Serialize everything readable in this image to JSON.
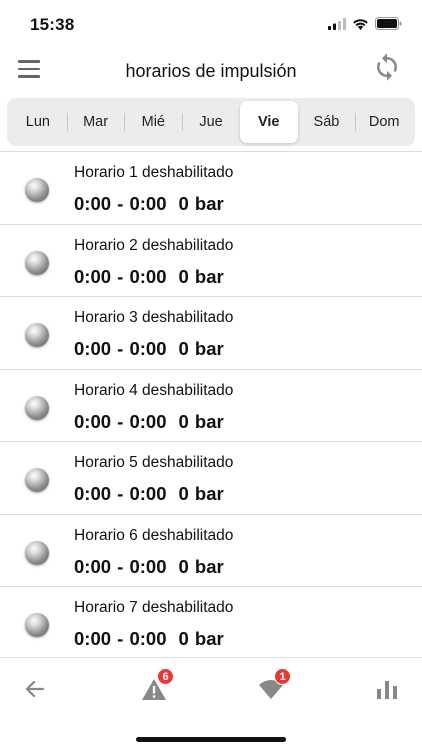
{
  "status_bar": {
    "time": "15:38"
  },
  "header": {
    "title": "horarios de impulsión"
  },
  "days": [
    {
      "label": "Lun",
      "active": false
    },
    {
      "label": "Mar",
      "active": false
    },
    {
      "label": "Mié",
      "active": false
    },
    {
      "label": "Jue",
      "active": false
    },
    {
      "label": "Vie",
      "active": true
    },
    {
      "label": "Sáb",
      "active": false
    },
    {
      "label": "Dom",
      "active": false
    }
  ],
  "schedules": [
    {
      "label": "Horario 1 deshabilitado",
      "time": "0:00 - 0:00",
      "pressure": "0 bar"
    },
    {
      "label": "Horario 2 deshabilitado",
      "time": "0:00 - 0:00",
      "pressure": "0 bar"
    },
    {
      "label": "Horario 3 deshabilitado",
      "time": "0:00 - 0:00",
      "pressure": "0 bar"
    },
    {
      "label": "Horario 4 deshabilitado",
      "time": "0:00 - 0:00",
      "pressure": "0 bar"
    },
    {
      "label": "Horario 5 deshabilitado",
      "time": "0:00 - 0:00",
      "pressure": "0 bar"
    },
    {
      "label": "Horario 6 deshabilitado",
      "time": "0:00 - 0:00",
      "pressure": "0 bar"
    },
    {
      "label": "Horario 7 deshabilitado",
      "time": "0:00 - 0:00",
      "pressure": "0 bar"
    }
  ],
  "bottom_nav": {
    "alerts_badge": "6",
    "notifications_badge": "1"
  },
  "icons": {
    "menu": "hamburger-icon",
    "refresh": "sync-icon",
    "back": "arrow-left-icon",
    "alerts": "warning-triangle-icon",
    "notifications": "signal-icon",
    "stats": "bar-chart-icon"
  },
  "colors": {
    "badge": "#e53935",
    "tab_bar": "#ececec",
    "icon_gray": "#888888"
  }
}
